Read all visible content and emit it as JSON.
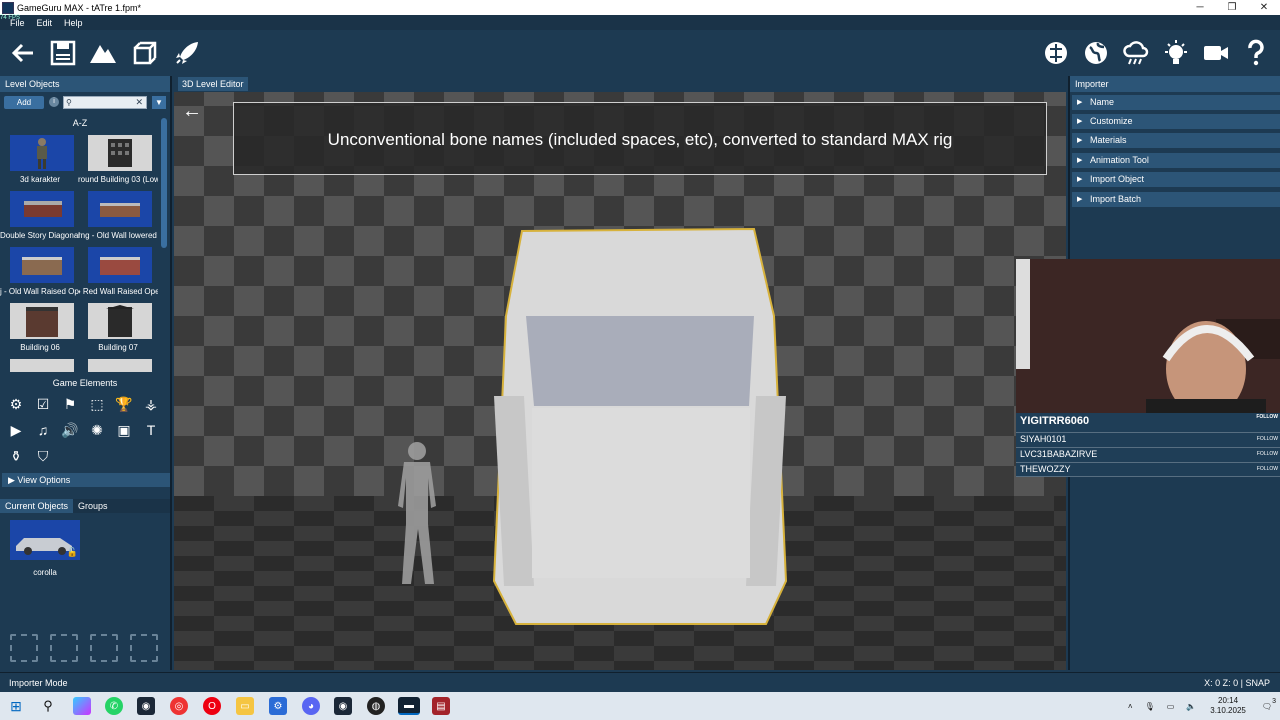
{
  "window": {
    "title": "GameGuru MAX - tATre 1.fpm*",
    "fps_badge": "74 FPS"
  },
  "menu": {
    "items": [
      "File",
      "Edit",
      "Help"
    ]
  },
  "toolbar": {
    "left_icons": [
      "back-arrow-icon",
      "save-icon",
      "terrain-icon",
      "cube-icon",
      "rocket-icon"
    ],
    "right_icons": [
      "brain-icon",
      "globe-icon",
      "weather-icon",
      "lightbulb-icon",
      "camera-icon",
      "help-icon"
    ]
  },
  "left_panel": {
    "title": "Level Objects",
    "add_label": "Add",
    "info_label": "i",
    "search_placeholder": "",
    "sort_label": "A-Z",
    "objects": [
      {
        "label": "3d karakter"
      },
      {
        "label": "round Building 03 (Low"
      },
      {
        "label": "Double Story Diagonal"
      },
      {
        "label": "rng - Old Wall lowered F"
      },
      {
        "label": "j - Old Wall Raised Ope"
      },
      {
        "label": "- Red Wall Raised Ope"
      },
      {
        "label": "Building 06"
      },
      {
        "label": "Building 07"
      }
    ],
    "game_elements_title": "Game Elements",
    "view_options_label": "View Options",
    "tabs": [
      "Current Objects",
      "Groups"
    ],
    "current_object": "corolla"
  },
  "viewport": {
    "title": "3D Level Editor",
    "banner": "Unconventional bone names (included spaces, etc), converted to standard MAX rig"
  },
  "right_panel": {
    "title": "Importer",
    "sections": [
      "Name",
      "Customize",
      "Materials",
      "Animation Tool",
      "Import Object",
      "Import Batch"
    ]
  },
  "stream": {
    "follow_label": "FOLLOW",
    "followers": [
      "YIGITRR6060",
      "SIYAH0101",
      "LVC31BABAZIRVE",
      "THEWOZZY"
    ]
  },
  "status": {
    "mode": "Importer Mode",
    "coords": "X: 0 Z: 0 | SNAP"
  },
  "taskbar": {
    "time": "20:14",
    "date": "3.10.2025",
    "notification_count": "3"
  }
}
